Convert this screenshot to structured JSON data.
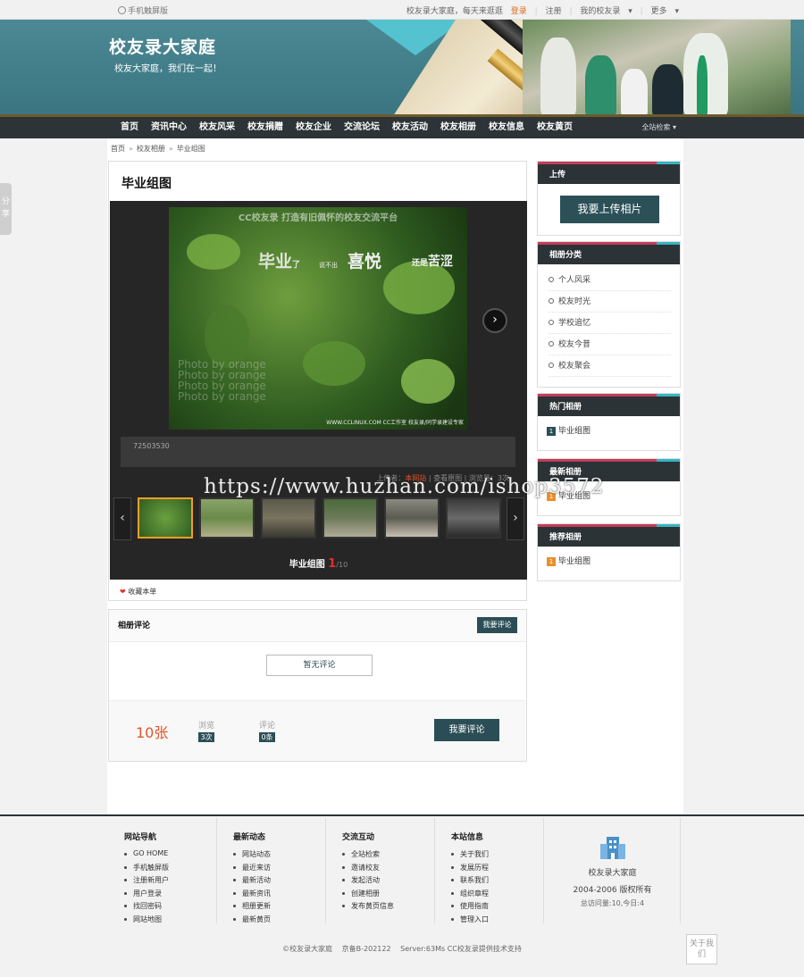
{
  "topbar": {
    "mobile": "手机触屏版",
    "welcome": "校友录大家庭，每天来逛逛",
    "login": "登录",
    "register": "注册",
    "my": "我的校友录",
    "more": "更多"
  },
  "banner": {
    "title": "校友录大家庭",
    "subtitle": "校友大家庭，我们在一起！"
  },
  "nav": {
    "items": [
      "首页",
      "资讯中心",
      "校友风采",
      "校友捐赠",
      "校友企业",
      "交流论坛",
      "校友活动",
      "校友相册",
      "校友信息",
      "校友黄页"
    ],
    "search": "全站检索"
  },
  "breadcrumb": [
    "首页",
    "校友相册",
    "毕业组图"
  ],
  "share": "分享",
  "album": {
    "title": "毕业组图",
    "photo_text": {
      "top": "CC校友录 打造有旧佩怀的校友交流平台",
      "w1": "毕业",
      "w1b": "了",
      "w2": "说不出",
      "w3": "喜悦",
      "w3b": "还是",
      "w4": "苦涩",
      "wm": [
        "Photo by orange",
        "Photo by orange",
        "Photo by orange",
        "Photo by orange"
      ],
      "credit": "WWW.CCLINUX.COM CC工作室 校友录/同学录建设专家"
    },
    "description": "72503530",
    "meta": {
      "uploader_label": "上传者：",
      "uploader": "本网站",
      "view_original": "查看原图",
      "views": "浏览量：3次"
    },
    "strip_title": "毕业组图",
    "current": "1",
    "total": "/10",
    "favorite": "收藏本单"
  },
  "comments": {
    "title": "相册评论",
    "add": "我要评论",
    "empty": "暂无评论",
    "count": "10张",
    "views_label": "浏览",
    "views": "3次",
    "comments_label": "评论",
    "comments_value": "0条",
    "add_big": "我要评论"
  },
  "sidebar": {
    "upload": {
      "title": "上传",
      "button": "我要上传相片"
    },
    "categories": {
      "title": "相册分类",
      "items": [
        "个人风采",
        "校友时光",
        "学校追忆",
        "校友今昔",
        "校友聚会"
      ]
    },
    "hot": {
      "title": "热门相册",
      "items": [
        "毕业组图"
      ]
    },
    "latest": {
      "title": "最新相册",
      "items": [
        "毕业组图"
      ]
    },
    "recommend": {
      "title": "推荐相册",
      "items": [
        "毕业组图"
      ]
    }
  },
  "footer": {
    "cols": [
      {
        "title": "网站导航",
        "items": [
          "GO HOME",
          "手机触屏版",
          "注册新用户",
          "用户登录",
          "找回密码",
          "网站地图"
        ]
      },
      {
        "title": "最新动态",
        "items": [
          "网站动态",
          "最近来访",
          "最新活动",
          "最新资讯",
          "相册更新",
          "最新黄页"
        ]
      },
      {
        "title": "交流互动",
        "items": [
          "全站检索",
          "邀请校友",
          "发起活动",
          "创建相册",
          "发布黄页信息"
        ]
      },
      {
        "title": "本站信息",
        "items": [
          "关于我们",
          "发展历程",
          "联系我们",
          "组织章程",
          "使用指南",
          "管理入口"
        ]
      }
    ],
    "site": "校友录大家庭",
    "rights": "2004-2006 版权所有",
    "visits": "总访问量:10,今日:4",
    "copyright": "©校友录大家庭",
    "icp": "京备B-202122",
    "server": "Server:63Ms CC校友录提供技术支持",
    "about": "关于我们"
  },
  "overlay_watermark": "https://www.huzhan.com/ishop3572",
  "colors": {
    "accent": "#2b4e56",
    "nav": "#2d3336",
    "orange": "#e2552a"
  }
}
